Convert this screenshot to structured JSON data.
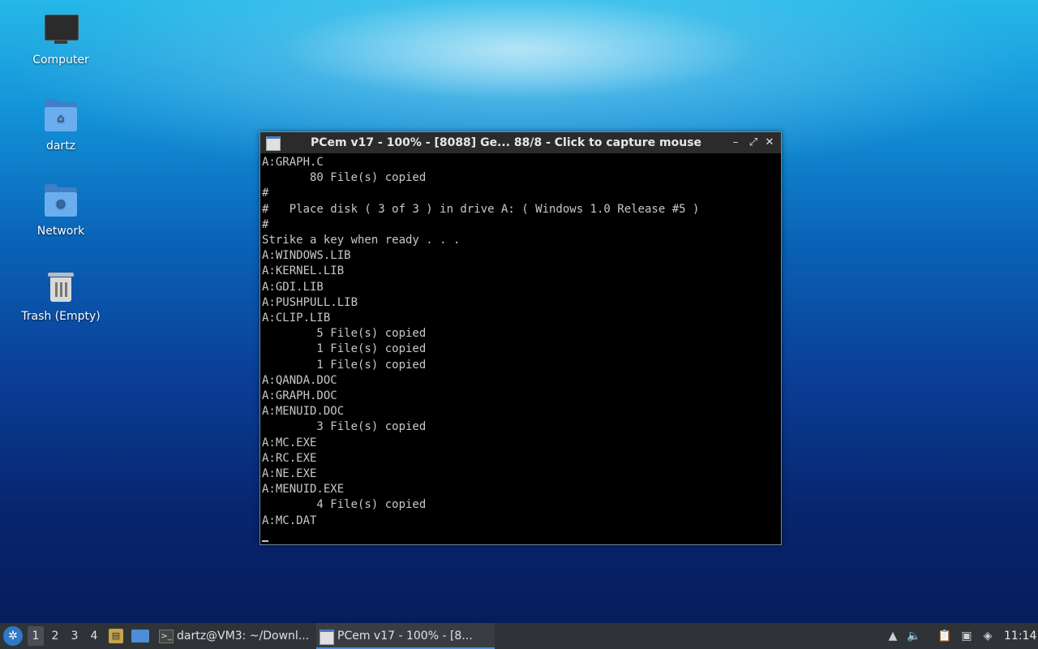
{
  "desktop": {
    "icons": [
      {
        "label": "Computer",
        "icon": "monitor-icon"
      },
      {
        "label": "dartz",
        "icon": "home-folder-icon"
      },
      {
        "label": "Network",
        "icon": "network-folder-icon"
      },
      {
        "label": "Trash (Empty)",
        "icon": "trash-icon"
      }
    ]
  },
  "window": {
    "title": "PCem v17 - 100% - [8088] Ge... 88/8 - Click to capture mouse",
    "controls": {
      "minimize": "–",
      "maximize": "⤢",
      "close": "✕"
    },
    "console_lines": [
      "A:GRAPH.C",
      "       80 File(s) copied",
      "#",
      "#   Place disk ( 3 of 3 ) in drive A: ( Windows 1.0 Release #5 )",
      "#",
      "Strike a key when ready . . .",
      "A:WINDOWS.LIB",
      "A:KERNEL.LIB",
      "A:GDI.LIB",
      "A:PUSHPULL.LIB",
      "A:CLIP.LIB",
      "        5 File(s) copied",
      "        1 File(s) copied",
      "        1 File(s) copied",
      "A:QANDA.DOC",
      "A:GRAPH.DOC",
      "A:MENUID.DOC",
      "        3 File(s) copied",
      "A:MC.EXE",
      "A:RC.EXE",
      "A:NE.EXE",
      "A:MENUID.EXE",
      "        4 File(s) copied",
      "A:MC.DAT"
    ]
  },
  "taskbar": {
    "menu_icon": "start-menu-icon",
    "workspaces": [
      "1",
      "2",
      "3",
      "4"
    ],
    "active_workspace": "1",
    "tasks": [
      {
        "label": "dartz@VM3: ~/Downl...",
        "icon": "terminal-icon"
      },
      {
        "label": "PCem v17 - 100% - [8...",
        "icon": "pcem-icon"
      }
    ],
    "clock": "11:14"
  }
}
